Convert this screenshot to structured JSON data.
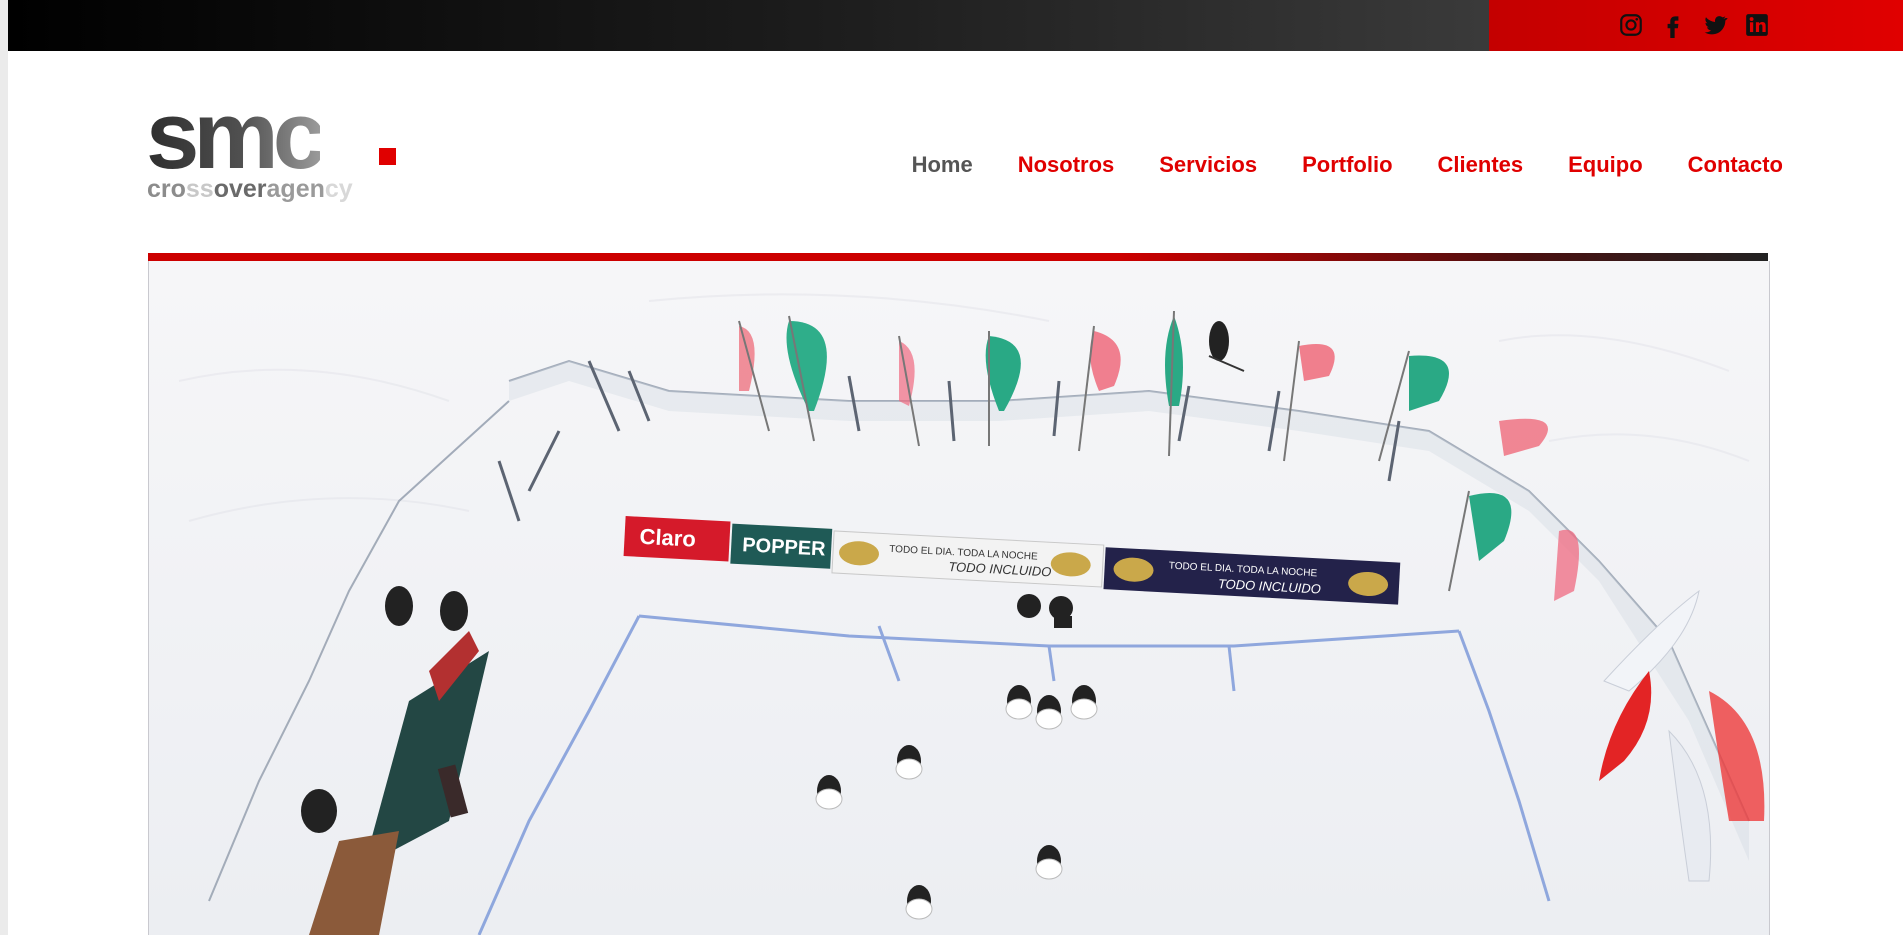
{
  "brand": {
    "name": "smc",
    "subtitle_parts": [
      "cro",
      "ss",
      "over",
      "agen",
      "cy"
    ]
  },
  "social": [
    {
      "name": "instagram-icon"
    },
    {
      "name": "facebook-icon"
    },
    {
      "name": "twitter-icon"
    },
    {
      "name": "linkedin-icon"
    }
  ],
  "nav": {
    "items": [
      {
        "label": "Home",
        "active": true
      },
      {
        "label": "Nosotros"
      },
      {
        "label": "Servicios"
      },
      {
        "label": "Portfolio"
      },
      {
        "label": "Clientes"
      },
      {
        "label": "Equipo"
      },
      {
        "label": "Contacto"
      }
    ]
  },
  "hero": {
    "banners": {
      "claro": "Claro",
      "popper": "POPPER",
      "hardrock_1": "TODO EL DIA. TODA LA NOCHE",
      "hardrock_1b": "TODO INCLUIDO",
      "hardrock_2": "TODO EL DIA. TODA LA NOCHE",
      "hardrock_2b": "TODO INCLUIDO"
    }
  },
  "colors": {
    "accent": "#e00000",
    "nav_active": "#555555",
    "topbar_dark": "#000000"
  }
}
